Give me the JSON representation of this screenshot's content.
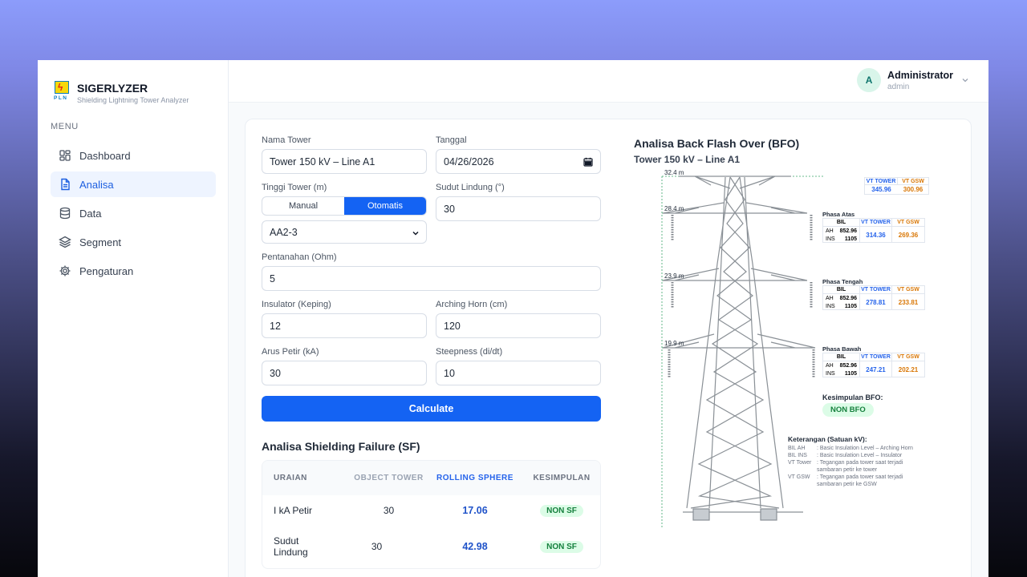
{
  "brand": {
    "logo_text": "PLN",
    "title": "SIGERLYZER",
    "subtitle": "Shielding Lightning Tower Analyzer"
  },
  "sidebar": {
    "menu_label": "MENU",
    "items": [
      {
        "label": "Dashboard",
        "icon": "dashboard-icon",
        "active": false
      },
      {
        "label": "Analisa",
        "icon": "document-icon",
        "active": true
      },
      {
        "label": "Data",
        "icon": "database-icon",
        "active": false
      },
      {
        "label": "Segment",
        "icon": "layers-icon",
        "active": false
      },
      {
        "label": "Pengaturan",
        "icon": "gear-icon",
        "active": false
      }
    ]
  },
  "user": {
    "initial": "A",
    "name": "Administrator",
    "role": "admin"
  },
  "form": {
    "nama_tower": {
      "label": "Nama Tower",
      "value": "Tower 150 kV – Line A1"
    },
    "tanggal": {
      "label": "Tanggal",
      "value": "04/26/2026"
    },
    "tinggi_tower": {
      "label": "Tinggi Tower (m)",
      "mode_manual": "Manual",
      "mode_otomatis": "Otomatis",
      "selected": "AA2-3"
    },
    "sudut_lindung": {
      "label": "Sudut Lindung (°)",
      "value": "30"
    },
    "pentanahan": {
      "label": "Pentanahan (Ohm)",
      "value": "5"
    },
    "insulator": {
      "label": "Insulator (Keping)",
      "value": "12"
    },
    "arching_horn": {
      "label": "Arching Horn (cm)",
      "value": "120"
    },
    "arus_petir": {
      "label": "Arus Petir (kA)",
      "value": "30"
    },
    "steepness": {
      "label": "Steepness (di/dt)",
      "value": "10"
    },
    "calculate_label": "Calculate"
  },
  "sf": {
    "title": "Analisa Shielding Failure (SF)",
    "headers": [
      "URAIAN",
      "OBJECT TOWER",
      "ROLLING SPHERE",
      "KESIMPULAN"
    ],
    "rows": [
      {
        "uraian": "I kA Petir",
        "object": "30",
        "rolling": "17.06",
        "kesimpulan": "NON SF"
      },
      {
        "uraian": "Sudut Lindung",
        "object": "30",
        "rolling": "42.98",
        "kesimpulan": "NON SF"
      }
    ]
  },
  "bfo": {
    "title": "Analisa Back Flash Over (BFO)",
    "tower_name": "Tower 150 kV – Line A1",
    "heights": [
      "32.4 m",
      "28.4 m",
      "23.9 m",
      "19.9 m"
    ],
    "vt_tower_label": "VT TOWER",
    "vt_gsw_label": "VT GSW",
    "bil_label": "BIL",
    "ah_label": "AH",
    "ins_label": "INS",
    "top": {
      "vt_tower": "345.96",
      "vt_gsw": "300.96"
    },
    "phases": [
      {
        "name": "Phasa Atas",
        "ah": "852.96",
        "ins": "1105",
        "vt_tower": "314.36",
        "vt_gsw": "269.36"
      },
      {
        "name": "Phasa Tengah",
        "ah": "852.96",
        "ins": "1105",
        "vt_tower": "278.81",
        "vt_gsw": "233.81"
      },
      {
        "name": "Phasa Bawah",
        "ah": "852.96",
        "ins": "1105",
        "vt_tower": "247.21",
        "vt_gsw": "202.21"
      }
    ],
    "kesimpulan_label": "Kesimpulan BFO:",
    "kesimpulan_value": "NON BFO",
    "keterangan_title": "Keterangan (Satuan kV):",
    "keterangan": [
      {
        "key": "BIL AH",
        "desc": ": Basic Insulation Level – Arching Horn"
      },
      {
        "key": "BIL INS",
        "desc": ": Basic Insulation Level – Insulator"
      },
      {
        "key": "VT Tower",
        "desc": ": Tegangan pada tower saat terjadi sambaran petir ke tower"
      },
      {
        "key": "VT GSW",
        "desc": ": Tegangan pada tower saat terjadi sambaran petir ke GSW"
      }
    ]
  },
  "colors": {
    "primary": "#1463f3",
    "success_bg": "#dcfce7",
    "success_text": "#15803d",
    "vt_tower": "#2563eb",
    "vt_gsw": "#d97706",
    "tower_steel": "#8a9096"
  }
}
